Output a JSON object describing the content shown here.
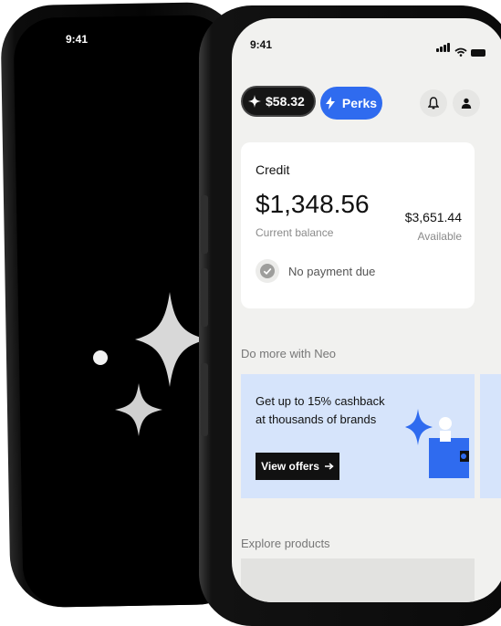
{
  "back_phone": {
    "time": "9:41",
    "icons": [
      "sparkle-large-icon",
      "sparkle-small-icon",
      "dot-icon"
    ]
  },
  "front_phone": {
    "status_bar": {
      "time": "9:41",
      "icons": [
        "signal-icon",
        "wifi-icon",
        "battery-icon"
      ]
    },
    "header": {
      "balance_pill": {
        "icon": "sparkle-icon",
        "label": "$58.32"
      },
      "perks_button": {
        "icon": "lightning-icon",
        "label": "Perks"
      },
      "actions": [
        "bell-icon",
        "profile-icon"
      ]
    },
    "credit": {
      "title": "Credit",
      "balance": "$1,348.56",
      "balance_label": "Current balance",
      "available": "$3,651.44",
      "available_label": "Available",
      "payment_status": "No payment due"
    },
    "do_more": {
      "section_title": "Do more with Neo",
      "promo": {
        "text_line1": "Get up to 15% cashback",
        "text_line2": "at thousands of brands",
        "button_label": "View offers",
        "button_icon": "arrow-right-icon"
      }
    },
    "explore": {
      "section_title": "Explore products"
    }
  },
  "colors": {
    "accent_blue": "#2f6bef",
    "promo_bg": "#d6e4fb",
    "screen_bg": "#f1f1ef",
    "phone_frame": "#0a0a0a"
  }
}
